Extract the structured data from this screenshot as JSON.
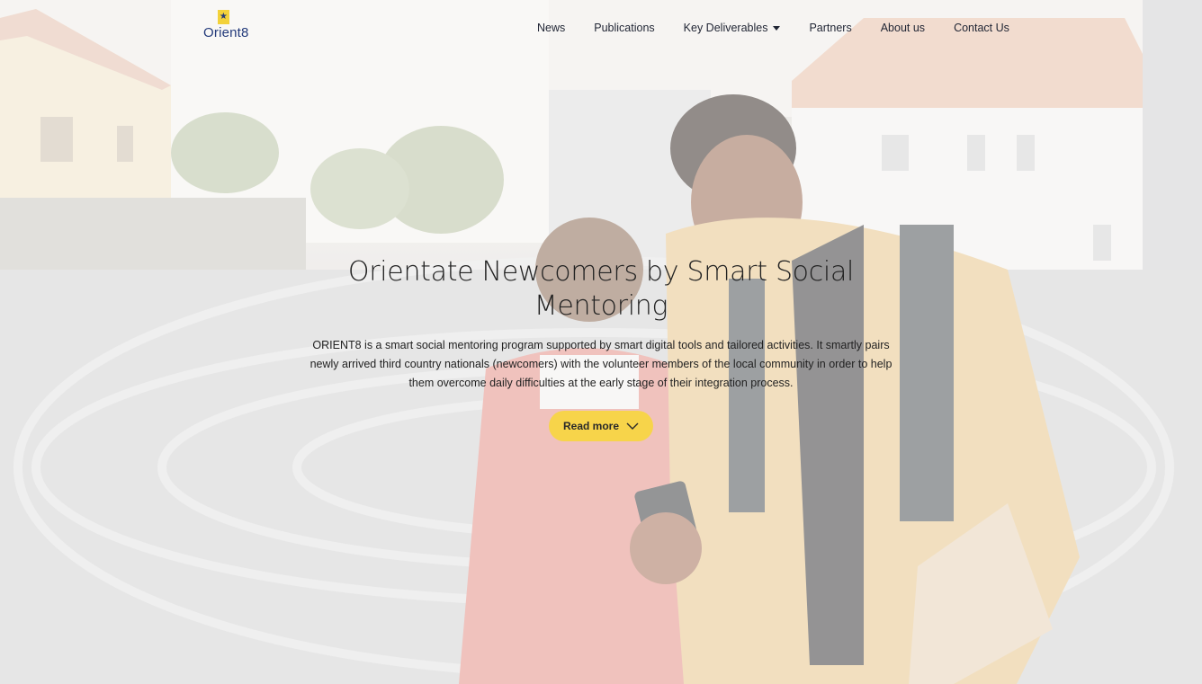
{
  "logo": {
    "text": "Orient8",
    "star": "★"
  },
  "nav": {
    "items": [
      {
        "label": "News"
      },
      {
        "label": "Publications"
      },
      {
        "label": "Key Deliverables"
      },
      {
        "label": "Partners"
      },
      {
        "label": "About us"
      },
      {
        "label": "Contact Us"
      }
    ]
  },
  "hero": {
    "title": "Orientate Newcomers by Smart Social Mentoring",
    "text": "ORIENT8 is a smart social mentoring program supported by smart digital tools and tailored activities. It smartly pairs newly arrived third country nationals (newcomers) with the volunteer members of the local community in order to help them overcome daily difficulties at the early stage of their integration process.",
    "button_label": "Read more"
  },
  "colors": {
    "accent": "#f7d44a",
    "logo_blue": "#233a7a",
    "text": "#222222"
  },
  "icons": {
    "dropdown": "caret-down-icon",
    "button": "chevron-down-icon"
  }
}
